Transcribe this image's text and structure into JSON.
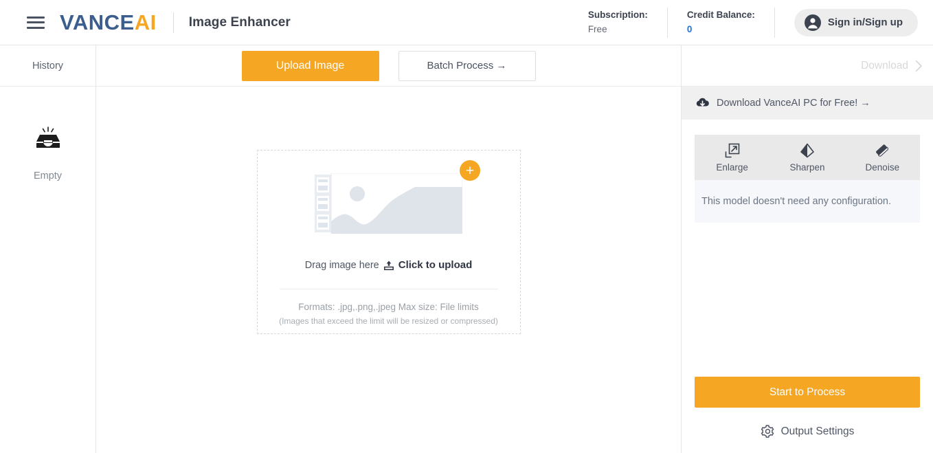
{
  "header": {
    "menu_icon": "hamburger-menu-icon",
    "logo_primary": "VANCE",
    "logo_accent": "AI",
    "app_title": "Image Enhancer",
    "subscription_label": "Subscription:",
    "subscription_value": "Free",
    "credit_label": "Credit Balance:",
    "credit_value": "0",
    "signin_label": "Sign in/Sign up",
    "signin_icon": "user-account-icon",
    "accent_color": "#f5a623",
    "logo_blue": "#3b5e8c",
    "credit_color": "#1a73e8"
  },
  "sidebar": {
    "title": "History",
    "empty_icon": "empty-tray-icon",
    "empty_label": "Empty"
  },
  "workspace": {
    "upload_button": "Upload Image",
    "batch_button": "Batch Process →",
    "dropzone": {
      "plus_badge": "+",
      "drag_text": "Drag image here",
      "upload_icon": "upload-arrow-icon",
      "click_text": "Click to upload",
      "formats": "Formats: .jpg,.png,.jpeg Max size: File limits",
      "formats_note": "(Images that exceed the limit will be resized or compressed)",
      "placeholder_icon": "image-placeholder-icon"
    }
  },
  "rightpanel": {
    "download_label": "Download",
    "download_chevron": "chevron-right-icon",
    "promo_icon": "download-cloud-icon",
    "promo_text": "Download VanceAI PC for Free! →",
    "tools": [
      {
        "label": "Enlarge",
        "icon": "enlarge-icon"
      },
      {
        "label": "Sharpen",
        "icon": "sharpen-icon"
      },
      {
        "label": "Denoise",
        "icon": "denoise-eraser-icon"
      }
    ],
    "config_message": "This model doesn't need any configuration.",
    "process_button": "Start to Process",
    "output_settings_label": "Output Settings",
    "output_settings_icon": "gear-icon"
  }
}
